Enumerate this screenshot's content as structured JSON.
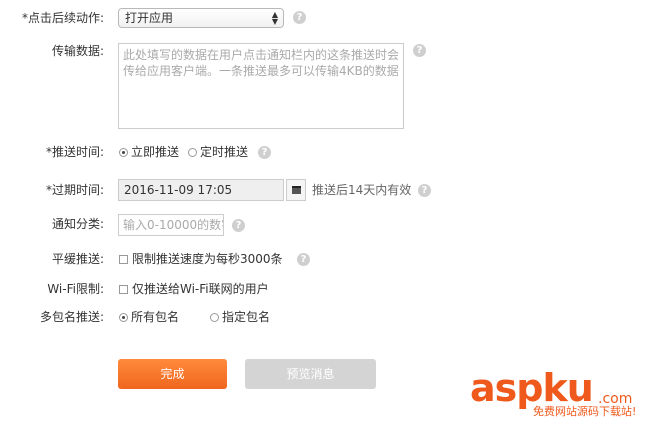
{
  "form": {
    "click_action": {
      "label": "*点击后续动作:",
      "value": "打开应用"
    },
    "payload": {
      "label": "传输数据:",
      "placeholder": "此处填写的数据在用户点击通知栏内的这条推送时会传给应用客户端。一条推送最多可以传输4KB的数据"
    },
    "push_time": {
      "label": "*推送时间:",
      "options": [
        "立即推送",
        "定时推送"
      ],
      "selected": 0
    },
    "expire_time": {
      "label": "*过期时间:",
      "value": "2016-11-09 17:05",
      "hint": "推送后14天内有效"
    },
    "notify_category": {
      "label": "通知分类:",
      "placeholder": "输入0-10000的数字"
    },
    "smooth_push": {
      "label": "平缓推送:",
      "checkbox_label": "限制推送速度为每秒3000条",
      "checked": false
    },
    "wifi_limit": {
      "label": "Wi-Fi限制:",
      "checkbox_label": "仅推送给Wi-Fi联网的用户",
      "checked": false
    },
    "multi_package": {
      "label": "多包名推送:",
      "options": [
        "所有包名",
        "指定包名"
      ],
      "selected": 0
    }
  },
  "buttons": {
    "done": "完成",
    "preview": "预览消息"
  },
  "watermark": {
    "brand": "aspku",
    "tld": ".com",
    "slogan": "免费网站源码下载站!"
  },
  "icons": {
    "help": "question-circle-icon",
    "calendar": "calendar-icon",
    "select_arrows": "updown-arrows-icon"
  }
}
